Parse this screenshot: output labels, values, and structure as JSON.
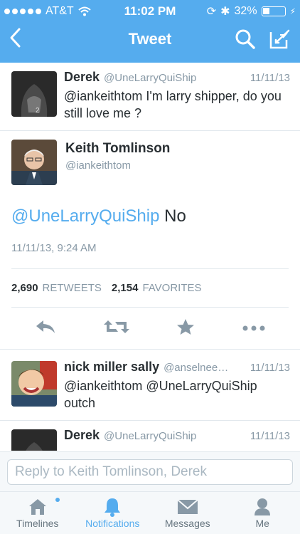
{
  "status_bar": {
    "carrier": "AT&T",
    "time": "11:02 PM",
    "battery": "32%"
  },
  "nav": {
    "title": "Tweet"
  },
  "tweets_top": [
    {
      "name": "Derek",
      "handle": "@UneLarryQuiShip",
      "time": "11/11/13",
      "text": "@iankeithtom I'm larry shipper, do you still love me ?"
    }
  ],
  "focus_tweet": {
    "name": "Keith Tomlinson",
    "handle": "@iankeithtom",
    "mention": "@UneLarryQuiShip",
    "text_after": " No",
    "datetime": "11/11/13, 9:24 AM",
    "retweets_count": "2,690",
    "retweets_label": "RETWEETS",
    "favorites_count": "2,154",
    "favorites_label": "FAVORITES"
  },
  "tweets_bottom": [
    {
      "name": "nick miller sally",
      "handle": "@anselnee…",
      "time": "11/11/13",
      "text": "@iankeithtom @UneLarryQuiShip outch"
    },
    {
      "name": "Derek",
      "handle": "@UneLarryQuiShip",
      "time": "11/11/13",
      "text": ""
    }
  ],
  "reply": {
    "placeholder": "Reply to Keith Tomlinson, Derek"
  },
  "tabs": [
    {
      "label": "Timelines"
    },
    {
      "label": "Notifications"
    },
    {
      "label": "Messages"
    },
    {
      "label": "Me"
    }
  ],
  "colors": {
    "brand": "#55acee",
    "text": "#292f33",
    "muted": "#8899a6"
  }
}
